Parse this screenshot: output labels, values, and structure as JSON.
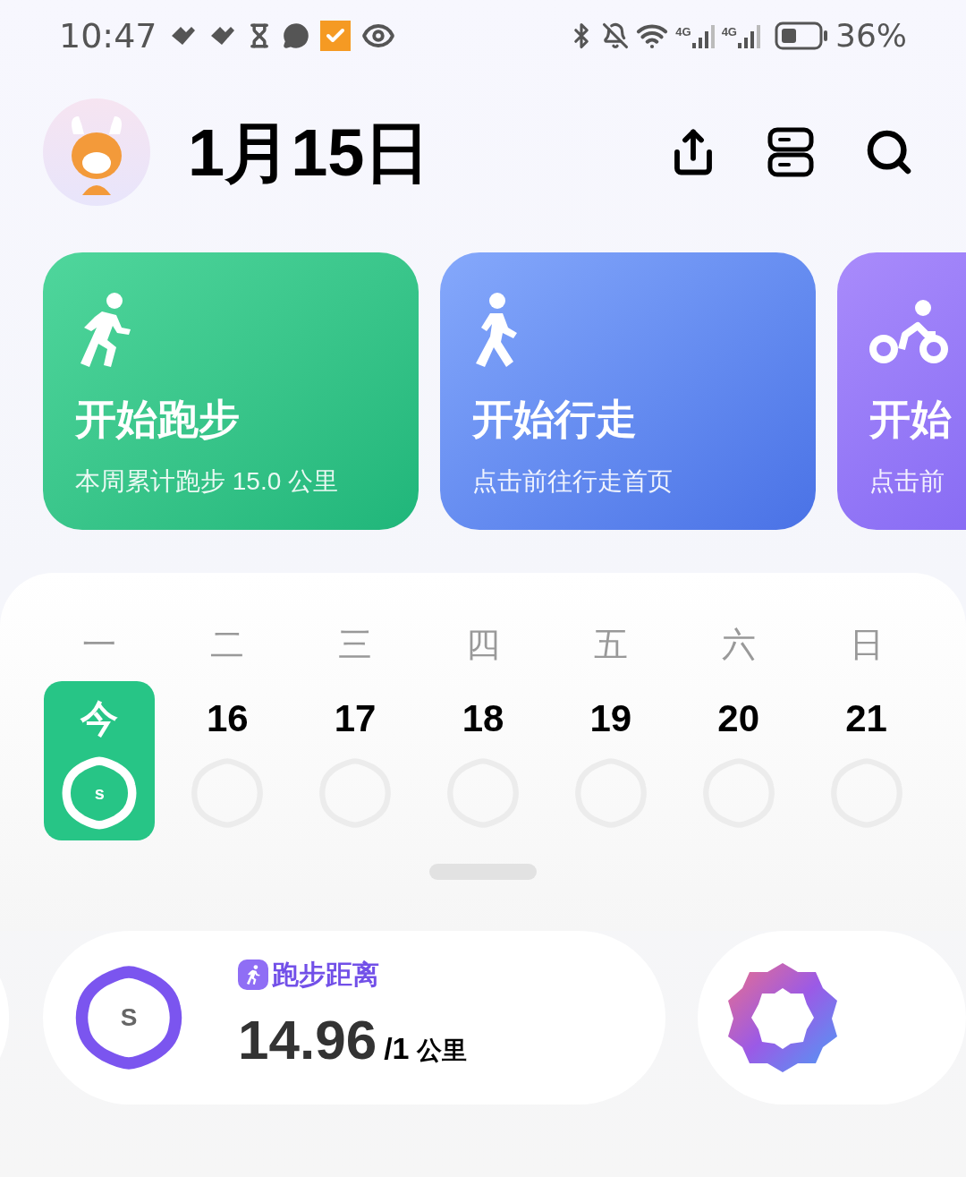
{
  "status_bar": {
    "time": "10:47",
    "network_labels": [
      "4G",
      "4G"
    ],
    "battery": "36%"
  },
  "header": {
    "date": "1月15日"
  },
  "cards": [
    {
      "kind": "run",
      "title": "开始跑步",
      "subtitle": "本周累计跑步 15.0 公里"
    },
    {
      "kind": "walk",
      "title": "开始行走",
      "subtitle": "点击前往行走首页"
    },
    {
      "kind": "cycle",
      "title": "开始",
      "subtitle": "点击前"
    }
  ],
  "calendar": {
    "weekdays": [
      "一",
      "二",
      "三",
      "四",
      "五",
      "六",
      "日"
    ],
    "days": [
      {
        "label": "今",
        "selected": true,
        "badge": "s"
      },
      {
        "label": "16",
        "selected": false
      },
      {
        "label": "17",
        "selected": false
      },
      {
        "label": "18",
        "selected": false
      },
      {
        "label": "19",
        "selected": false
      },
      {
        "label": "20",
        "selected": false
      },
      {
        "label": "21",
        "selected": false
      }
    ]
  },
  "distance": {
    "title": "跑步距离",
    "value": "14.96",
    "goal": "/1",
    "unit": "公里",
    "badge": "S"
  }
}
